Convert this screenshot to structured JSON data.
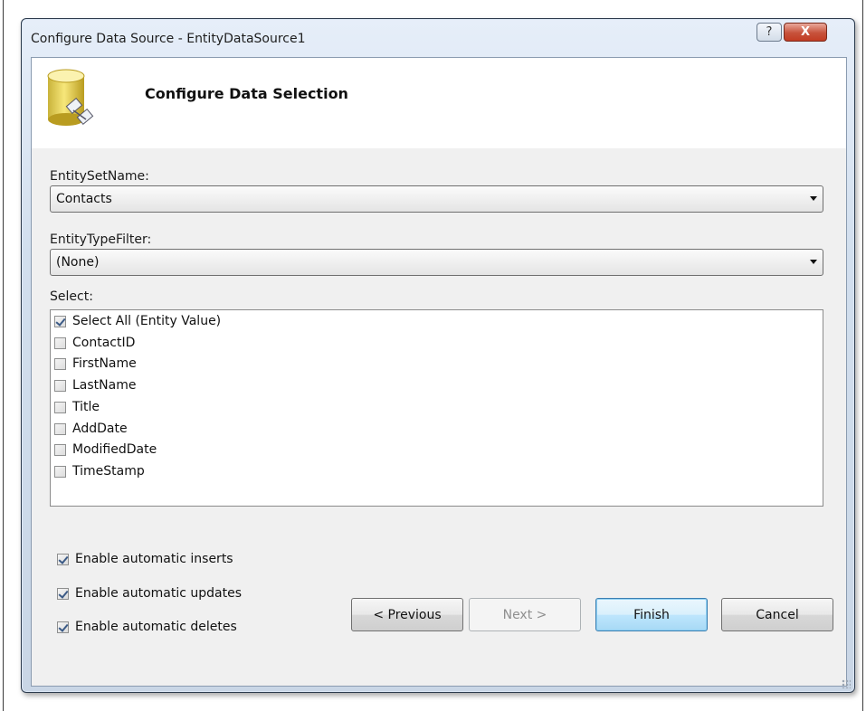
{
  "window": {
    "title": "Configure Data Source - EntityDataSource1",
    "help_glyph": "?",
    "close_glyph": "X"
  },
  "header": {
    "title": "Configure Data Selection"
  },
  "entity_set": {
    "label": "EntitySetName:",
    "value": "Contacts"
  },
  "entity_type_filter": {
    "label": "EntityTypeFilter:",
    "value": "(None)"
  },
  "select": {
    "label": "Select:",
    "items": [
      {
        "label": "Select All (Entity Value)",
        "checked": true
      },
      {
        "label": "ContactID",
        "checked": false
      },
      {
        "label": "FirstName",
        "checked": false
      },
      {
        "label": "LastName",
        "checked": false
      },
      {
        "label": "Title",
        "checked": false
      },
      {
        "label": "AddDate",
        "checked": false
      },
      {
        "label": "ModifiedDate",
        "checked": false
      },
      {
        "label": "TimeStamp",
        "checked": false
      }
    ]
  },
  "options": [
    {
      "label": "Enable automatic inserts",
      "checked": true
    },
    {
      "label": "Enable automatic updates",
      "checked": true
    },
    {
      "label": "Enable automatic deletes",
      "checked": true
    }
  ],
  "buttons": {
    "previous": "< Previous",
    "next": "Next >",
    "finish": "Finish",
    "cancel": "Cancel"
  }
}
